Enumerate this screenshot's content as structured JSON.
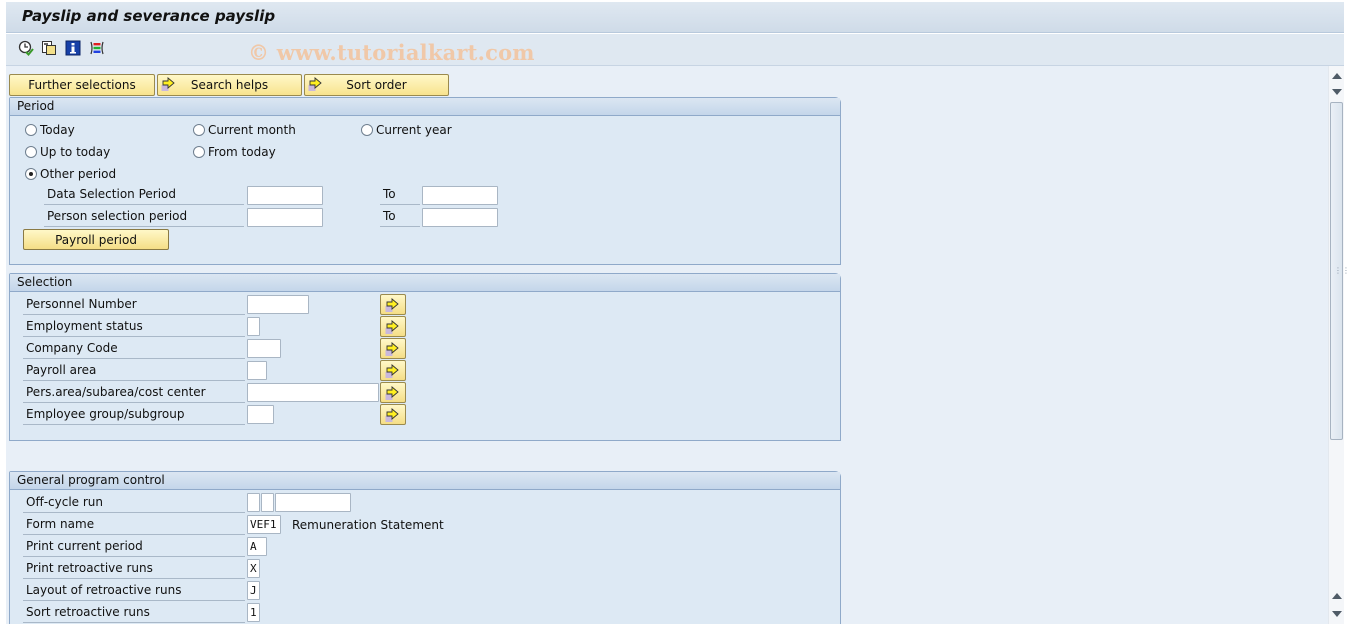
{
  "window": {
    "title": "Payslip and severance payslip",
    "watermark": "© www.tutorialkart.com"
  },
  "toolbar": {
    "icons": [
      {
        "name": "execute-schedule-icon",
        "glyph": "⏲"
      },
      {
        "name": "get-variant-icon",
        "glyph": "⧉"
      },
      {
        "name": "program-info-icon",
        "glyph": "i"
      },
      {
        "name": "selection-options-icon",
        "glyph": "≡"
      }
    ]
  },
  "topbuttons": {
    "further_selections": "Further selections",
    "search_helps": "Search helps",
    "sort_order": "Sort order"
  },
  "period": {
    "header": "Period",
    "radios": {
      "today": "Today",
      "current_month": "Current month",
      "current_year": "Current year",
      "up_to_today": "Up to today",
      "from_today": "From today",
      "other_period": "Other period"
    },
    "selected": "other_period",
    "data_selection_label": "Data Selection Period",
    "person_selection_label": "Person selection period",
    "to_label": "To",
    "data_from": "",
    "data_to": "",
    "person_from": "",
    "person_to": "",
    "payroll_period_button": "Payroll period"
  },
  "selection": {
    "header": "Selection",
    "fields": [
      {
        "label": "Personnel Number",
        "value": ""
      },
      {
        "label": "Employment status",
        "value": ""
      },
      {
        "label": "Company Code",
        "value": ""
      },
      {
        "label": "Payroll area",
        "value": ""
      },
      {
        "label": "Pers.area/subarea/cost center",
        "value": ""
      },
      {
        "label": "Employee group/subgroup",
        "value": ""
      }
    ]
  },
  "general": {
    "header": "General program control",
    "offcycle_label": "Off-cycle run",
    "offcycle_values": [
      "",
      "",
      ""
    ],
    "form_name_label": "Form name",
    "form_name_value": "VEF1",
    "form_name_desc": "Remuneration Statement",
    "print_current_label": "Print current period",
    "print_current_value": "A",
    "print_retro_label": "Print retroactive runs",
    "print_retro_value": "X",
    "layout_retro_label": "Layout of retroactive runs",
    "layout_retro_value": "J",
    "sort_retro_label": "Sort retroactive runs",
    "sort_retro_value": "1"
  },
  "colors": {
    "button_yellow": "#f8e38e",
    "group_border": "#8fa9c9",
    "watermark": "#f0c8a8"
  }
}
